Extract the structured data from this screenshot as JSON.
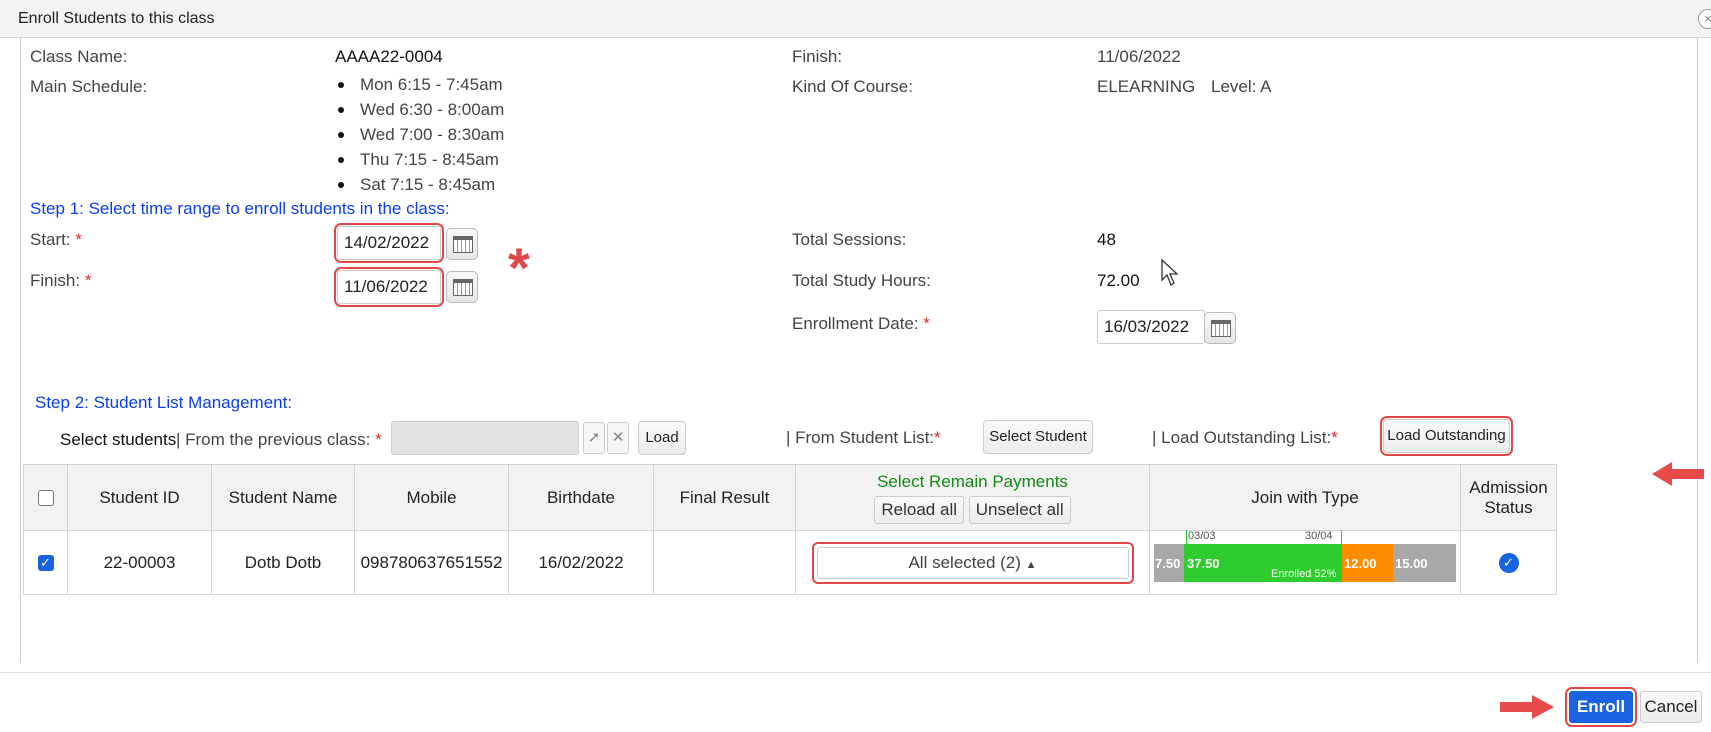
{
  "window": {
    "title": "Enroll Students to this class",
    "close_glyph": "×"
  },
  "class_info": {
    "class_name_label": "Class Name:",
    "class_name": "AAAA22-0004",
    "finish_label": "Finish:",
    "finish": "11/06/2022",
    "main_schedule_label": "Main Schedule:",
    "schedule": [
      "Mon 6:15 - 7:45am",
      "Wed 6:30 - 8:00am",
      "Wed 7:00 - 8:30am",
      "Thu 7:15 - 8:45am",
      "Sat 7:15 - 8:45am"
    ],
    "kind_of_course_label": "Kind Of Course:",
    "kind_of_course": "ELEARNING",
    "level": "Level: A"
  },
  "step1": {
    "heading": "Step 1: Select time range to enroll students in the class:",
    "start_label": "Start:",
    "start_value": "14/02/2022",
    "finish_label": "Finish:",
    "finish_value": "11/06/2022",
    "required_mark": "*",
    "total_sessions_label": "Total Sessions:",
    "total_sessions": "48",
    "total_hours_label": "Total Study Hours:",
    "total_hours": "72.00",
    "enrollment_date_label": "Enrollment Date:",
    "enrollment_date": "16/03/2022"
  },
  "step2": {
    "heading": "Step 2: Student List Management:",
    "select_students": "Select students",
    "from_previous_label": "| From the previous class:",
    "load_button": "Load",
    "from_student_list_label": "| From Student List:",
    "select_student_button": "Select Student",
    "load_outstanding_label": "| Load Outstanding List:",
    "load_outstanding_button": "Load Outstanding",
    "clear_glyph": "✕",
    "pointer_glyph": "➚"
  },
  "table": {
    "headers": {
      "student_id": "Student ID",
      "student_name": "Student Name",
      "mobile": "Mobile",
      "birthdate": "Birthdate",
      "final_result": "Final Result",
      "remain_payments": "Select Remain Payments",
      "reload_all": "Reload all",
      "unselect_all": "Unselect all",
      "join_type": "Join with Type",
      "admission_status": "Admission Status"
    },
    "rows": [
      {
        "student_id": "22-00003",
        "student_name": "Dotb Dotb",
        "mobile": "098780637651552",
        "birthdate": "16/02/2022",
        "final_result": "",
        "payments": "All selected (2)",
        "admission_glyph": "✓"
      }
    ]
  },
  "join_bar": {
    "segments": [
      {
        "label": "7.50",
        "color": "#a8a8a8"
      },
      {
        "label": "37.50",
        "color": "#2ecc2e"
      },
      {
        "label": "12.00",
        "color": "#ff8c00"
      },
      {
        "label": "15.00",
        "color": "#a8a8a8"
      }
    ],
    "marker_left": "03/03",
    "marker_right": "30/04",
    "enrolled_text": "Enrolled 52%"
  },
  "footer": {
    "enroll": "Enroll",
    "cancel": "Cancel"
  },
  "annotation": {
    "asterisk": "*",
    "color": "#e04848"
  }
}
